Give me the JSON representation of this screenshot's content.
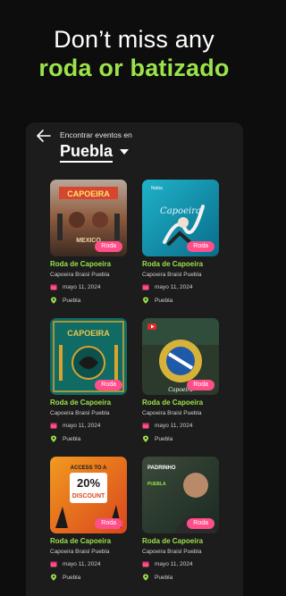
{
  "promo": {
    "line1": "Don’t miss any",
    "line2": "roda or batizado"
  },
  "colors": {
    "accent_green": "#9be34a",
    "badge_pink": "#ff4f8b",
    "panel": "#1c1c1c",
    "background": "#0d0d0d"
  },
  "header": {
    "find_label": "Encontrar eventos en",
    "city": "Puebla"
  },
  "events": [
    {
      "title": "Roda de Capoeira",
      "organizer": "Capoeira Braisl Puebla",
      "date": "mayo 11, 2024",
      "location": "Puebla",
      "badge": "Roda"
    },
    {
      "title": "Roda de Capoeira",
      "organizer": "Capoeira Braisl Puebla",
      "date": "mayo 11, 2024",
      "location": "Puebla",
      "badge": "Roda"
    },
    {
      "title": "Roda de Capoeira",
      "organizer": "Capoeira Braisl Puebla",
      "date": "mayo 11, 2024",
      "location": "Puebla",
      "badge": "Roda"
    },
    {
      "title": "Roda de Capoeira",
      "organizer": "Capoeira Braisl Puebla",
      "date": "mayo 11, 2024",
      "location": "Puebla",
      "badge": "Roda"
    },
    {
      "title": "Roda de Capoeira",
      "organizer": "Capoeira Braisl Puebla",
      "date": "mayo 11, 2024",
      "location": "Puebla",
      "badge": "Roda"
    },
    {
      "title": "Roda de Capoeira",
      "organizer": "Capoeira Braisl Puebla",
      "date": "mayo 11, 2024",
      "location": "Puebla",
      "badge": "Roda"
    }
  ],
  "thumb_art": {
    "t1_title": "CAPOEIRA",
    "t1_sub": "MEXICO",
    "t2_brand": "Nokia",
    "t2_title": "Capoeira",
    "t3_title": "CAPOEIRA",
    "t4_title": "Capoeira",
    "t5_line1": "ACCESS TO A",
    "t5_big": "20%",
    "t5_line2": "DISCOUNT",
    "t6_title": "PADRINHO",
    "t6_sub": "PUEBLA"
  }
}
